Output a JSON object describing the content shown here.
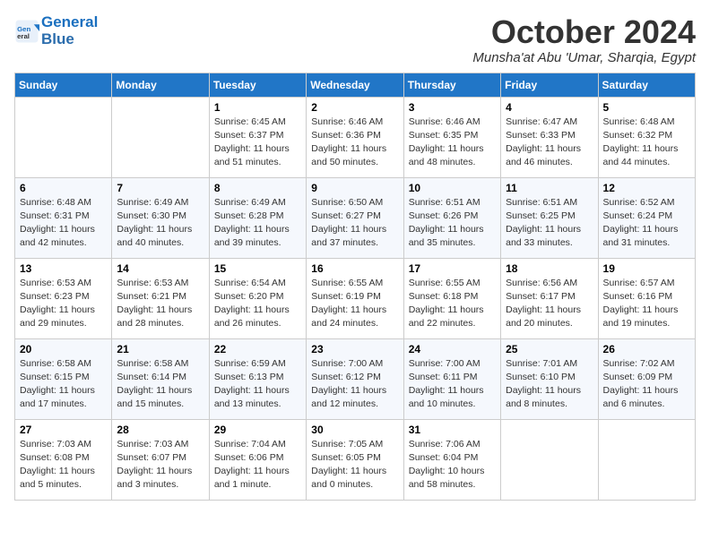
{
  "logo": {
    "line1": "General",
    "line2": "Blue"
  },
  "title": "October 2024",
  "subtitle": "Munsha'at Abu 'Umar, Sharqia, Egypt",
  "headers": [
    "Sunday",
    "Monday",
    "Tuesday",
    "Wednesday",
    "Thursday",
    "Friday",
    "Saturday"
  ],
  "weeks": [
    [
      {
        "day": "",
        "info": ""
      },
      {
        "day": "",
        "info": ""
      },
      {
        "day": "1",
        "info": "Sunrise: 6:45 AM\nSunset: 6:37 PM\nDaylight: 11 hours\nand 51 minutes."
      },
      {
        "day": "2",
        "info": "Sunrise: 6:46 AM\nSunset: 6:36 PM\nDaylight: 11 hours\nand 50 minutes."
      },
      {
        "day": "3",
        "info": "Sunrise: 6:46 AM\nSunset: 6:35 PM\nDaylight: 11 hours\nand 48 minutes."
      },
      {
        "day": "4",
        "info": "Sunrise: 6:47 AM\nSunset: 6:33 PM\nDaylight: 11 hours\nand 46 minutes."
      },
      {
        "day": "5",
        "info": "Sunrise: 6:48 AM\nSunset: 6:32 PM\nDaylight: 11 hours\nand 44 minutes."
      }
    ],
    [
      {
        "day": "6",
        "info": "Sunrise: 6:48 AM\nSunset: 6:31 PM\nDaylight: 11 hours\nand 42 minutes."
      },
      {
        "day": "7",
        "info": "Sunrise: 6:49 AM\nSunset: 6:30 PM\nDaylight: 11 hours\nand 40 minutes."
      },
      {
        "day": "8",
        "info": "Sunrise: 6:49 AM\nSunset: 6:28 PM\nDaylight: 11 hours\nand 39 minutes."
      },
      {
        "day": "9",
        "info": "Sunrise: 6:50 AM\nSunset: 6:27 PM\nDaylight: 11 hours\nand 37 minutes."
      },
      {
        "day": "10",
        "info": "Sunrise: 6:51 AM\nSunset: 6:26 PM\nDaylight: 11 hours\nand 35 minutes."
      },
      {
        "day": "11",
        "info": "Sunrise: 6:51 AM\nSunset: 6:25 PM\nDaylight: 11 hours\nand 33 minutes."
      },
      {
        "day": "12",
        "info": "Sunrise: 6:52 AM\nSunset: 6:24 PM\nDaylight: 11 hours\nand 31 minutes."
      }
    ],
    [
      {
        "day": "13",
        "info": "Sunrise: 6:53 AM\nSunset: 6:23 PM\nDaylight: 11 hours\nand 29 minutes."
      },
      {
        "day": "14",
        "info": "Sunrise: 6:53 AM\nSunset: 6:21 PM\nDaylight: 11 hours\nand 28 minutes."
      },
      {
        "day": "15",
        "info": "Sunrise: 6:54 AM\nSunset: 6:20 PM\nDaylight: 11 hours\nand 26 minutes."
      },
      {
        "day": "16",
        "info": "Sunrise: 6:55 AM\nSunset: 6:19 PM\nDaylight: 11 hours\nand 24 minutes."
      },
      {
        "day": "17",
        "info": "Sunrise: 6:55 AM\nSunset: 6:18 PM\nDaylight: 11 hours\nand 22 minutes."
      },
      {
        "day": "18",
        "info": "Sunrise: 6:56 AM\nSunset: 6:17 PM\nDaylight: 11 hours\nand 20 minutes."
      },
      {
        "day": "19",
        "info": "Sunrise: 6:57 AM\nSunset: 6:16 PM\nDaylight: 11 hours\nand 19 minutes."
      }
    ],
    [
      {
        "day": "20",
        "info": "Sunrise: 6:58 AM\nSunset: 6:15 PM\nDaylight: 11 hours\nand 17 minutes."
      },
      {
        "day": "21",
        "info": "Sunrise: 6:58 AM\nSunset: 6:14 PM\nDaylight: 11 hours\nand 15 minutes."
      },
      {
        "day": "22",
        "info": "Sunrise: 6:59 AM\nSunset: 6:13 PM\nDaylight: 11 hours\nand 13 minutes."
      },
      {
        "day": "23",
        "info": "Sunrise: 7:00 AM\nSunset: 6:12 PM\nDaylight: 11 hours\nand 12 minutes."
      },
      {
        "day": "24",
        "info": "Sunrise: 7:00 AM\nSunset: 6:11 PM\nDaylight: 11 hours\nand 10 minutes."
      },
      {
        "day": "25",
        "info": "Sunrise: 7:01 AM\nSunset: 6:10 PM\nDaylight: 11 hours\nand 8 minutes."
      },
      {
        "day": "26",
        "info": "Sunrise: 7:02 AM\nSunset: 6:09 PM\nDaylight: 11 hours\nand 6 minutes."
      }
    ],
    [
      {
        "day": "27",
        "info": "Sunrise: 7:03 AM\nSunset: 6:08 PM\nDaylight: 11 hours\nand 5 minutes."
      },
      {
        "day": "28",
        "info": "Sunrise: 7:03 AM\nSunset: 6:07 PM\nDaylight: 11 hours\nand 3 minutes."
      },
      {
        "day": "29",
        "info": "Sunrise: 7:04 AM\nSunset: 6:06 PM\nDaylight: 11 hours\nand 1 minute."
      },
      {
        "day": "30",
        "info": "Sunrise: 7:05 AM\nSunset: 6:05 PM\nDaylight: 11 hours\nand 0 minutes."
      },
      {
        "day": "31",
        "info": "Sunrise: 7:06 AM\nSunset: 6:04 PM\nDaylight: 10 hours\nand 58 minutes."
      },
      {
        "day": "",
        "info": ""
      },
      {
        "day": "",
        "info": ""
      }
    ]
  ]
}
